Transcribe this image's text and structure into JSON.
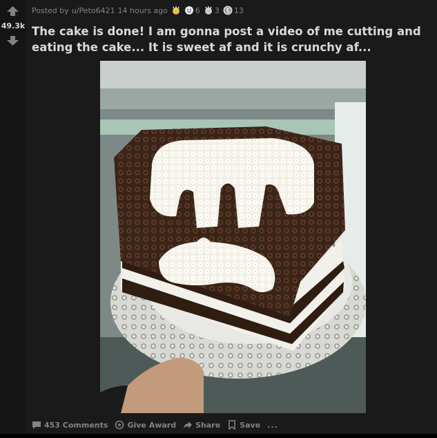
{
  "post": {
    "score": "49.3k",
    "posted_by_prefix": "Posted by",
    "author": "u/Peto6421",
    "time": "14 hours ago",
    "awards": [
      {
        "icon": "hands-award-icon",
        "count": ""
      },
      {
        "icon": "wholesome-award-icon",
        "count": "6"
      },
      {
        "icon": "clapping-award-icon",
        "count": "3"
      },
      {
        "icon": "silver-coin-award-icon",
        "count": "13"
      }
    ],
    "title": "The cake is done! I am gonna post a video of me cutting and eating the cake... It is sweet af and it is crunchy af...",
    "image": {
      "subject": "cake-photo"
    }
  },
  "actions": {
    "comments": "453 Comments",
    "give_award": "Give Award",
    "share": "Share",
    "save": "Save",
    "more": "..."
  },
  "colors": {
    "background": "#1a1a1b",
    "vote_bar": "#151516",
    "text": "#d7dadc",
    "muted": "#818384"
  }
}
